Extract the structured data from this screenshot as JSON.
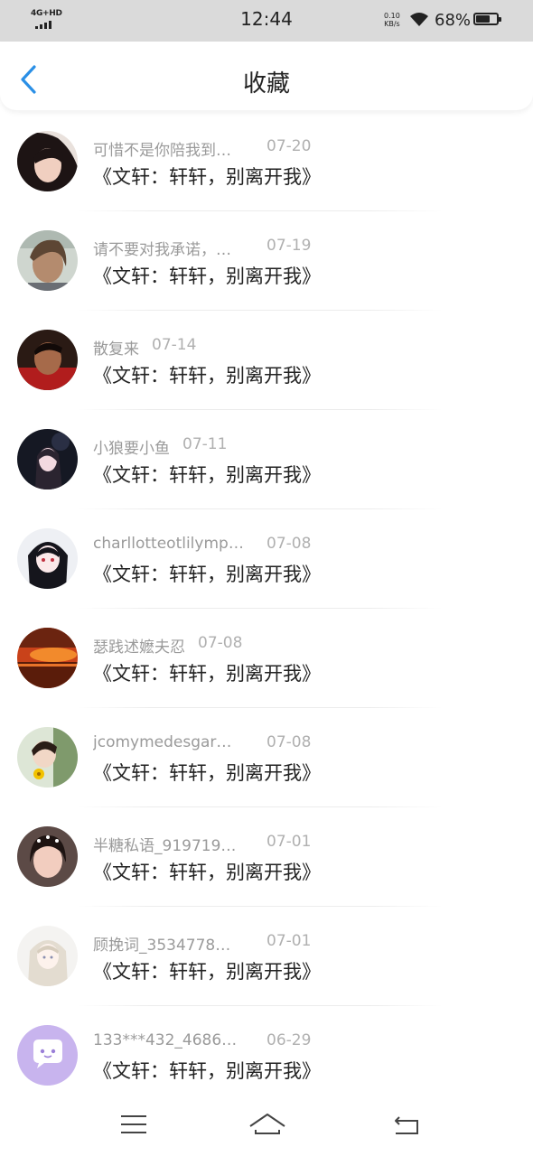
{
  "status_bar": {
    "network": "4G+HD",
    "time": "12:44",
    "speed_value": "0.10",
    "speed_unit": "KB/s",
    "battery_percent": "68%",
    "battery_level": 0.68
  },
  "header": {
    "title": "收藏",
    "back_icon": "chevron-left-icon",
    "accent_color": "#2a8fe6"
  },
  "favorites": [
    {
      "name": "可惜不是你陪我到…",
      "date": "07-20",
      "content": "《文轩：轩轩，别离开我》",
      "avatar": "portrait-woman-dark-hair"
    },
    {
      "name": "请不要对我承诺，…",
      "date": "07-19",
      "content": "《文轩：轩轩，别离开我》",
      "avatar": "portrait-woman-selfie"
    },
    {
      "name": "散复来",
      "date": "07-14",
      "content": "《文轩：轩轩，别离开我》",
      "avatar": "portrait-boy-red"
    },
    {
      "name": "小狼要小鱼",
      "date": "07-11",
      "content": "《文轩：轩轩，别离开我》",
      "avatar": "anime-girl-night"
    },
    {
      "name": "charllotteotlilymp…",
      "date": "07-08",
      "content": "《文轩：轩轩，别离开我》",
      "avatar": "anime-girl-black-hair"
    },
    {
      "name": "瑟践述嬷夫忍",
      "date": "07-08",
      "content": "《文轩：轩轩，别离开我》",
      "avatar": "sunset-landscape"
    },
    {
      "name": "jcomymedesgar…",
      "date": "07-08",
      "content": "《文轩：轩轩，别离开我》",
      "avatar": "girl-with-flower"
    },
    {
      "name": "半糖私语_919719…",
      "date": "07-01",
      "content": "《文轩：轩轩，别离开我》",
      "avatar": "portrait-girl-filter"
    },
    {
      "name": "顾挽词_3534778…",
      "date": "07-01",
      "content": "《文轩：轩轩，别离开我》",
      "avatar": "anime-girl-light-hair"
    },
    {
      "name": "133***432_4686…",
      "date": "06-29",
      "content": "《文轩：轩轩，别离开我》",
      "avatar": "default-chat-avatar"
    }
  ],
  "bottom_nav": {
    "menu_icon": "menu-icon",
    "home_icon": "home-icon",
    "back_icon": "return-icon"
  }
}
